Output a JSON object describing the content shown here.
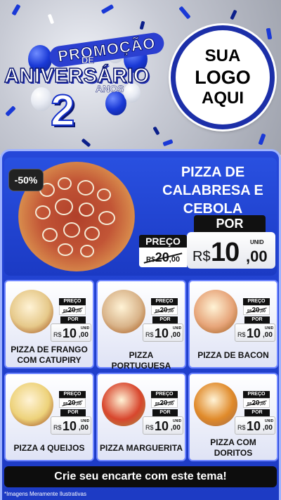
{
  "header": {
    "promo_word": "PROMOÇÃO",
    "de_word": "DE",
    "aniversario_word": "ANIVERSÁRIO",
    "anos_number": "2",
    "anos_word": "ANOS",
    "logo_lines": [
      "SUA",
      "LOGO",
      "AQUI"
    ]
  },
  "featured": {
    "discount": "-50%",
    "title": "PIZZA DE CALABRESA E CEBOLA",
    "preco_label": "PREÇO",
    "old_currency": "R$",
    "old_int": "20",
    "old_dec": ",00",
    "por_label": "POR",
    "unid_label": "UNID",
    "new_currency": "R$",
    "new_int": "10",
    "new_dec": ",00"
  },
  "cards": [
    {
      "name": "PIZZA DE FRANGO COM CATUPIRY",
      "preco_label": "PREÇO",
      "old_currency": "R$",
      "old_int": "20",
      "old_dec": ",00",
      "por_label": "POR",
      "unid_label": "UNID",
      "new_currency": "R$",
      "new_int": "10",
      "new_dec": ",00",
      "color": "#e6c98a"
    },
    {
      "name": "PIZZA PORTUGUESA",
      "preco_label": "PREÇO",
      "old_currency": "R$",
      "old_int": "20",
      "old_dec": ",00",
      "por_label": "POR",
      "unid_label": "UNID",
      "new_currency": "R$",
      "new_int": "10",
      "new_dec": ",00",
      "color": "#d9b48a"
    },
    {
      "name": "PIZZA DE BACON",
      "preco_label": "PREÇO",
      "old_currency": "R$",
      "old_int": "20",
      "old_dec": ",00",
      "por_label": "POR",
      "unid_label": "UNID",
      "new_currency": "R$",
      "new_int": "10",
      "new_dec": ",00",
      "color": "#e7a57a"
    },
    {
      "name": "PIZZA 4 QUEIJOS",
      "preco_label": "PREÇO",
      "old_currency": "R$",
      "old_int": "20",
      "old_dec": ",00",
      "por_label": "POR",
      "unid_label": "UNID",
      "new_currency": "R$",
      "new_int": "10",
      "new_dec": ",00",
      "color": "#edd27a"
    },
    {
      "name": "PIZZA MARGUERITA",
      "preco_label": "PREÇO",
      "old_currency": "R$",
      "old_int": "20",
      "old_dec": ",00",
      "por_label": "POR",
      "unid_label": "UNID",
      "new_currency": "R$",
      "new_int": "10",
      "new_dec": ",00",
      "color": "#d8462d"
    },
    {
      "name": "PIZZA COM DORITOS",
      "preco_label": "PREÇO",
      "old_currency": "R$",
      "old_int": "20",
      "old_dec": ",00",
      "por_label": "POR",
      "unid_label": "UNID",
      "new_currency": "R$",
      "new_int": "10",
      "new_dec": ",00",
      "color": "#e08a2a"
    }
  ],
  "footer": {
    "cta": "Crie seu encarte com este tema!",
    "disclaimer": "*Imagens Meramente Ilustrativas"
  },
  "colors": {
    "panel_blue": "#1d3bc4",
    "accent_blue": "#2547d8",
    "price_black": "#111111"
  }
}
